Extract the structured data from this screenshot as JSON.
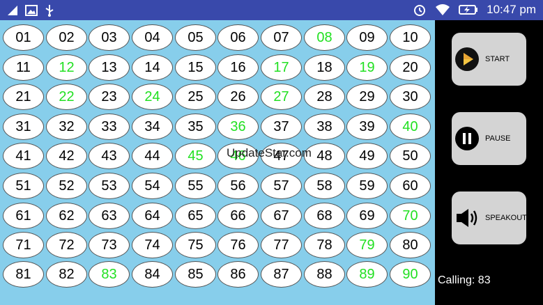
{
  "status_bar": {
    "time": "10:47 pm",
    "left_icons": [
      "signal-icon",
      "image-icon",
      "usb-icon"
    ],
    "right_icons": [
      "alarm-icon",
      "wifi-icon",
      "battery-charging-icon"
    ]
  },
  "board": {
    "numbers": [
      "01",
      "02",
      "03",
      "04",
      "05",
      "06",
      "07",
      "08",
      "09",
      "10",
      "11",
      "12",
      "13",
      "14",
      "15",
      "16",
      "17",
      "18",
      "19",
      "20",
      "21",
      "22",
      "23",
      "24",
      "25",
      "26",
      "27",
      "28",
      "29",
      "30",
      "31",
      "32",
      "33",
      "34",
      "35",
      "36",
      "37",
      "38",
      "39",
      "40",
      "41",
      "42",
      "43",
      "44",
      "45",
      "46",
      "47",
      "48",
      "49",
      "50",
      "51",
      "52",
      "53",
      "54",
      "55",
      "56",
      "57",
      "58",
      "59",
      "60",
      "61",
      "62",
      "63",
      "64",
      "65",
      "66",
      "67",
      "68",
      "69",
      "70",
      "71",
      "72",
      "73",
      "74",
      "75",
      "76",
      "77",
      "78",
      "79",
      "80",
      "81",
      "82",
      "83",
      "84",
      "85",
      "86",
      "87",
      "88",
      "89",
      "90"
    ],
    "called": [
      "08",
      "12",
      "17",
      "19",
      "22",
      "24",
      "27",
      "36",
      "40",
      "45",
      "46",
      "70",
      "79",
      "83",
      "89",
      "90"
    ],
    "called_color": "#22e022"
  },
  "watermark": "UpdateStar.com",
  "controls": {
    "start_label": "START",
    "pause_label": "PAUSE",
    "speakout_label": "SPEAKOUT"
  },
  "calling_text": "Calling: 83"
}
